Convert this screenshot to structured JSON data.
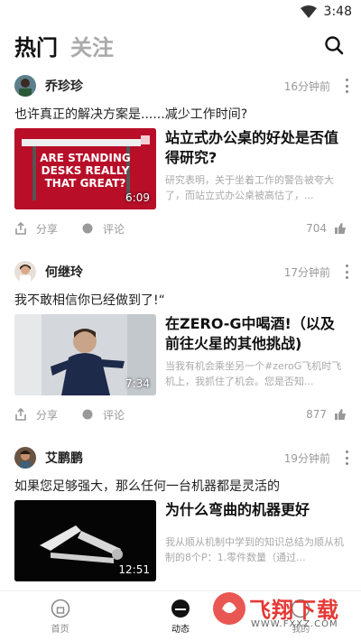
{
  "status": {
    "time": "3:48"
  },
  "header": {
    "tabs": [
      {
        "label": "热门"
      },
      {
        "label": "关注"
      }
    ]
  },
  "posts": [
    {
      "author": "乔珍珍",
      "time_ago": "16分钟前",
      "quote": "也许真正的解决方案是......减少工作时间?",
      "title": "站立式办公桌的好处是否值得研究?",
      "desc": "研究表明，关于坐着工作的警告被夸大了，而站立式办公桌被高估了，...",
      "duration": "6:09",
      "thumb_text": [
        "ARE STANDING",
        "DESKS REALLY",
        "THAT GREAT?"
      ],
      "share_label": "分享",
      "comment_label": "评论",
      "likes": "704"
    },
    {
      "author": "何继玲",
      "time_ago": "17分钟前",
      "quote": "我不敢相信你已经做到了!“",
      "title": "在ZERO-G中喝酒!（以及前往火星的其他挑战)",
      "desc": "当我有机会乘坐另一个#zeroG飞机时飞机上，我抓住了机会。您是否知...",
      "duration": "7:34",
      "share_label": "分享",
      "comment_label": "评论",
      "likes": "877"
    },
    {
      "author": "艾鹏鹏",
      "time_ago": "19分钟前",
      "quote": "如果您足够强大，那么任何一台机器都是灵活的",
      "title": "为什么弯曲的机器更好",
      "desc": "我从顺从机制中学到的知识总结为顺从机制的8个P：1.零件数量（通过...",
      "duration": "12:51"
    }
  ],
  "bottom_nav": [
    {
      "label": "首页",
      "icon": "home-icon"
    },
    {
      "label": "动态",
      "icon": "feed-icon"
    },
    {
      "label": "我的",
      "icon": "profile-icon"
    }
  ],
  "watermark": {
    "text": "飞翔下载",
    "url": "WWW.FXXZ.COM"
  },
  "colors": {
    "accent_red": "#c8102e",
    "watermark_red": "#e53935"
  }
}
